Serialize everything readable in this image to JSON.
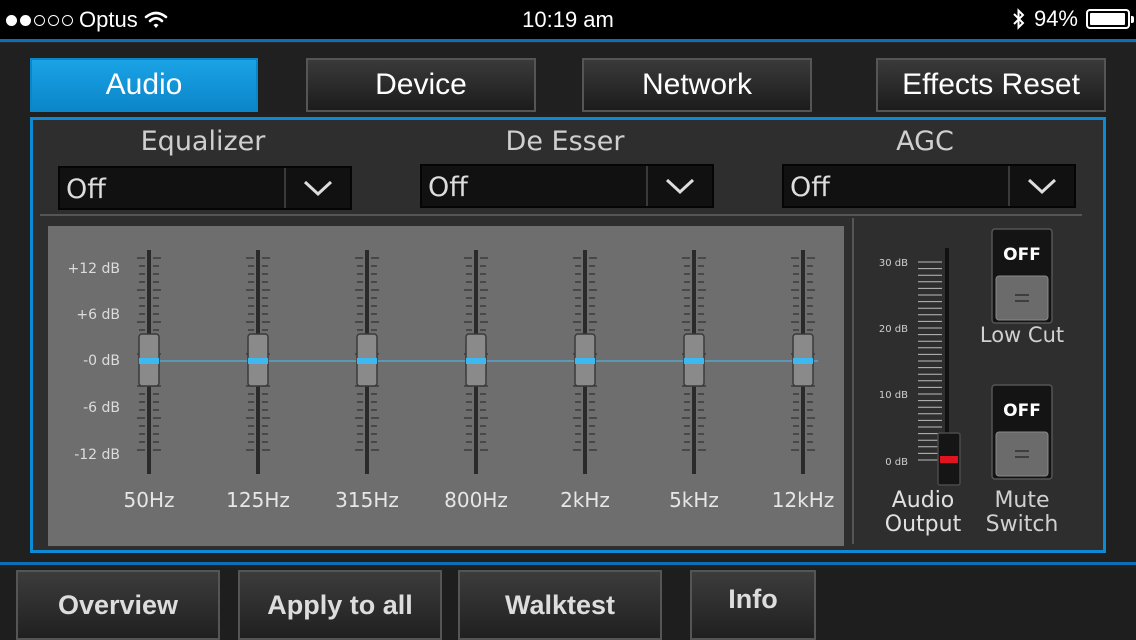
{
  "status_bar": {
    "carrier": "Optus",
    "signal_bars_filled": 2,
    "signal_bars_total": 5,
    "time": "10:19 am",
    "battery_percent": "94%"
  },
  "tabs": [
    {
      "label": "Audio",
      "active": true
    },
    {
      "label": "Device",
      "active": false
    },
    {
      "label": "Network",
      "active": false
    },
    {
      "label": "Effects Reset",
      "active": false
    }
  ],
  "dropdowns": {
    "equalizer": {
      "label": "Equalizer",
      "value": "Off"
    },
    "de_esser": {
      "label": "De Esser",
      "value": "Off"
    },
    "agc": {
      "label": "AGC",
      "value": "Off"
    }
  },
  "equalizer": {
    "scale_labels": [
      "+12 dB",
      "+6 dB",
      "-0 dB",
      "-6 dB",
      "-12 dB"
    ],
    "bands": [
      {
        "label": "50Hz",
        "gain_db": 0
      },
      {
        "label": "125Hz",
        "gain_db": 0
      },
      {
        "label": "315Hz",
        "gain_db": 0
      },
      {
        "label": "800Hz",
        "gain_db": 0
      },
      {
        "label": "2kHz",
        "gain_db": 0
      },
      {
        "label": "5kHz",
        "gain_db": 0
      },
      {
        "label": "12kHz",
        "gain_db": 0
      }
    ]
  },
  "audio_output": {
    "label_line1": "Audio",
    "label_line2": "Output",
    "scale_labels": [
      "30 dB",
      "20 dB",
      "10 dB",
      "0 dB"
    ],
    "value_db": 0
  },
  "low_cut": {
    "state": "OFF",
    "label": "Low Cut"
  },
  "mute_switch": {
    "state": "OFF",
    "label_line1": "Mute",
    "label_line2": "Switch"
  },
  "bottom_tabs": [
    {
      "label": "Overview"
    },
    {
      "label": "Apply to all"
    },
    {
      "label": "Walktest"
    },
    {
      "label": "Info"
    }
  ],
  "colors": {
    "accent": "#0e8ad4",
    "slider_marker": "#3db8f0",
    "output_marker": "#e0141e"
  }
}
